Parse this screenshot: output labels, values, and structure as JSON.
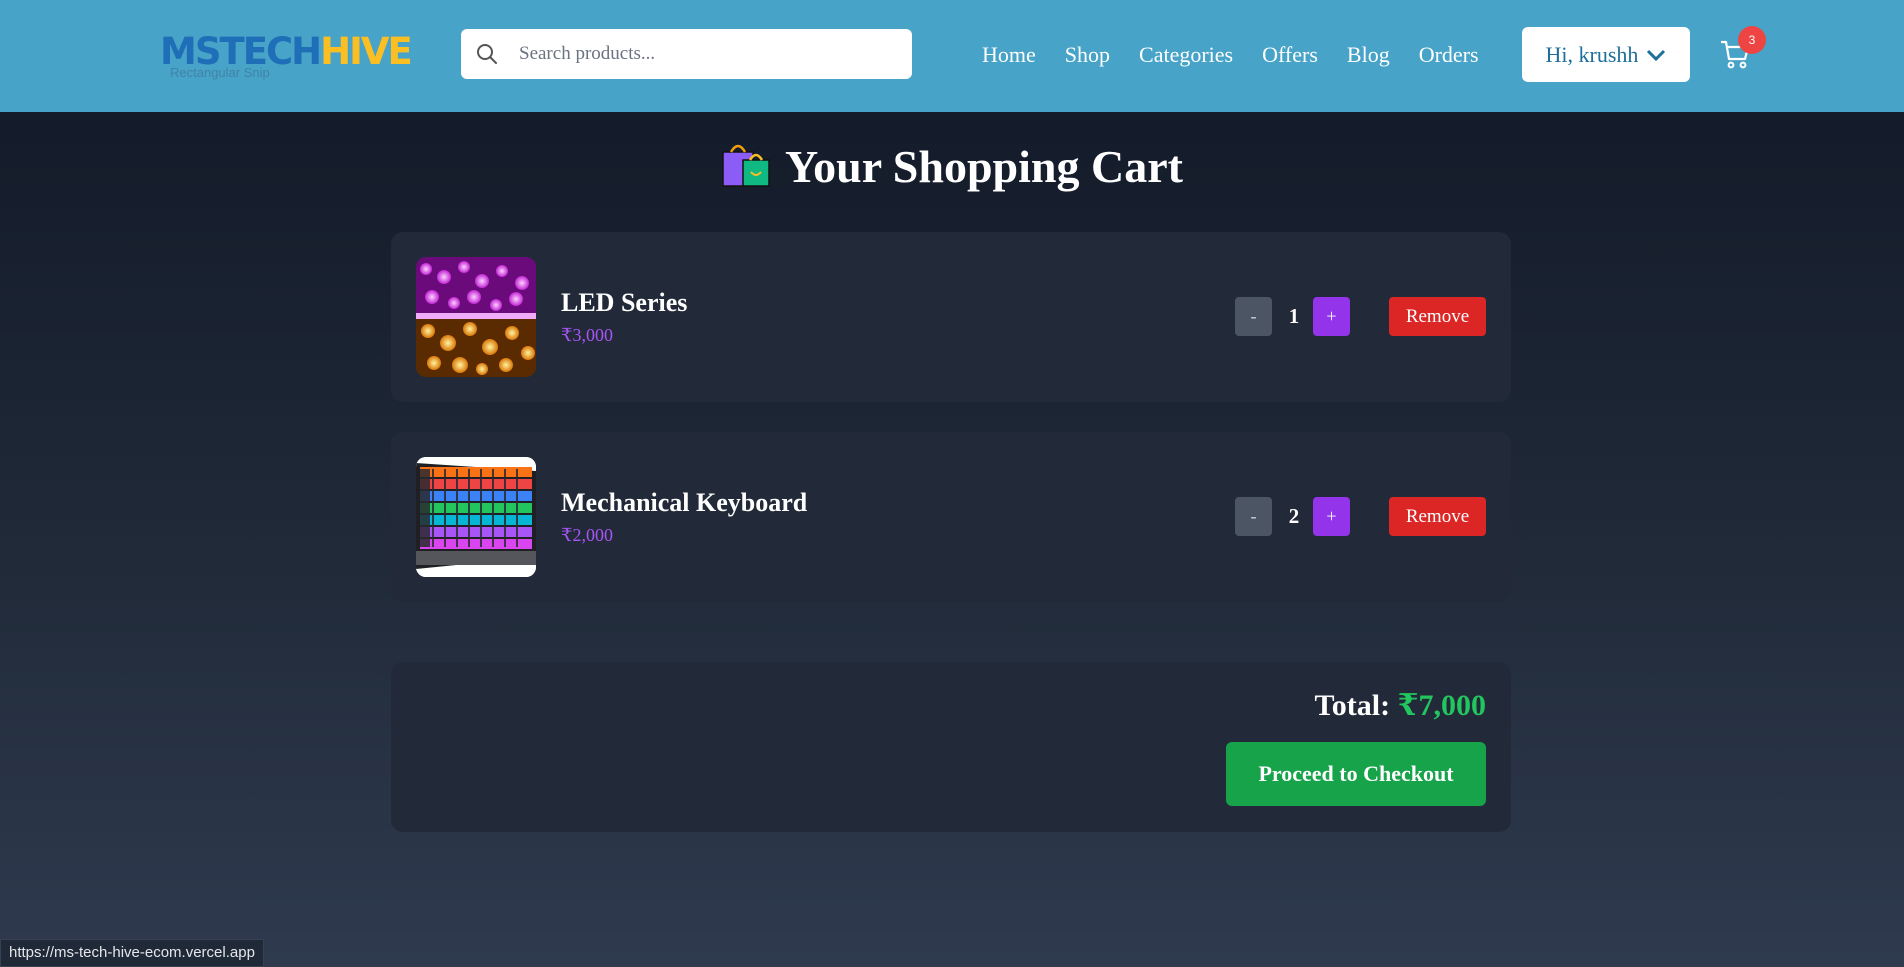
{
  "header": {
    "logo_ms": "MSTECH",
    "logo_hive": "HIVE",
    "logo_sub": "Rectangular Snip",
    "search_placeholder": "Search products...",
    "nav": [
      "Home",
      "Shop",
      "Categories",
      "Offers",
      "Blog",
      "Orders"
    ],
    "user_label": "Hi, krushh",
    "cart_count": "3"
  },
  "page": {
    "title": "Your Shopping Cart"
  },
  "cart": {
    "items": [
      {
        "name": "LED Series",
        "price": "₹3,000",
        "qty": "1",
        "minus": "-",
        "plus": "+",
        "remove": "Remove"
      },
      {
        "name": "Mechanical Keyboard",
        "price": "₹2,000",
        "qty": "2",
        "minus": "-",
        "plus": "+",
        "remove": "Remove"
      }
    ],
    "total_label": "Total:",
    "total_value": "₹7,000",
    "checkout_label": "Proceed to Checkout"
  },
  "status_url": "https://ms-tech-hive-ecom.vercel.app",
  "colors": {
    "navbar": "#47a3c7",
    "accent_purple": "#9333ea",
    "remove_red": "#dc2626",
    "checkout_green": "#16a34a",
    "total_green": "#22c55e"
  }
}
